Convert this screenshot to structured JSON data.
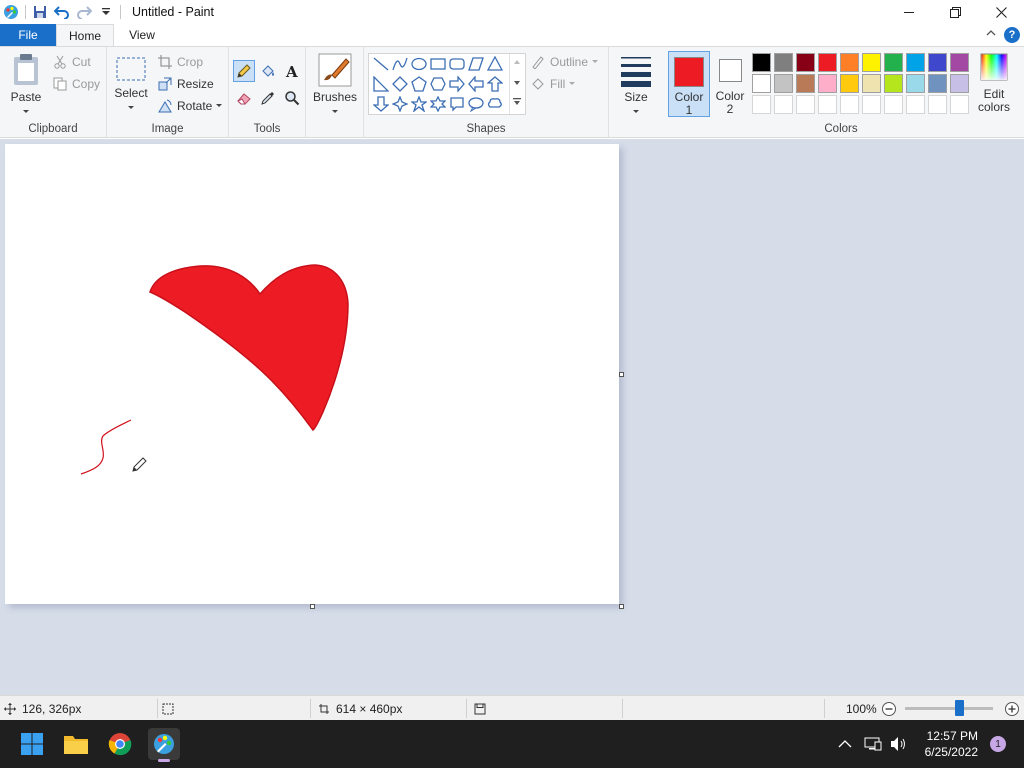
{
  "window": {
    "title": "Untitled - Paint"
  },
  "tabs": {
    "file": "File",
    "home": "Home",
    "view": "View"
  },
  "clipboard": {
    "paste": "Paste",
    "cut": "Cut",
    "copy": "Copy",
    "label": "Clipboard"
  },
  "image": {
    "select": "Select",
    "crop": "Crop",
    "resize": "Resize",
    "rotate": "Rotate",
    "label": "Image"
  },
  "tools": {
    "label": "Tools"
  },
  "brushes": {
    "label": "Brushes"
  },
  "shapes": {
    "outline": "Outline",
    "fill": "Fill",
    "label": "Shapes"
  },
  "size": {
    "label": "Size"
  },
  "color1": {
    "line1": "Color",
    "line2": "1",
    "value": "#ed1c24"
  },
  "color2": {
    "line1": "Color",
    "line2": "2",
    "value": "#ffffff"
  },
  "edit_colors": {
    "line1": "Edit",
    "line2": "colors"
  },
  "colors": {
    "label": "Colors",
    "row1": [
      "#000000",
      "#7f7f7f",
      "#880015",
      "#ed1c24",
      "#ff7f27",
      "#fff200",
      "#22b14c",
      "#00a2e8",
      "#3f48cc",
      "#a349a4"
    ],
    "row2": [
      "#ffffff",
      "#c3c3c3",
      "#b97a57",
      "#ffaec9",
      "#ffc90e",
      "#efe4b0",
      "#b5e61d",
      "#99d9ea",
      "#7092be",
      "#c8bfe7"
    ]
  },
  "status": {
    "cursor_pos": "126, 326px",
    "canvas_size": "614 × 460px",
    "zoom": "100%",
    "zoom_fraction": 0.62
  },
  "taskbar": {
    "time": "12:57 PM",
    "date": "6/25/2022",
    "notifications": "1"
  }
}
